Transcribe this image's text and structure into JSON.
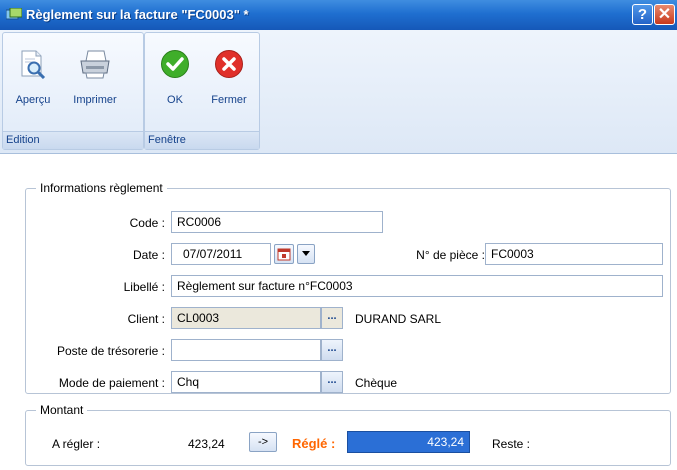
{
  "window": {
    "title": "Règlement sur la facture \"FC0003\" *",
    "help_label": "?",
    "close_label": "✕"
  },
  "ribbon": {
    "groups": [
      {
        "title": "Edition",
        "buttons": [
          {
            "label": "Aperçu",
            "icon": "preview-icon"
          },
          {
            "label": "Imprimer",
            "icon": "printer-icon"
          }
        ]
      },
      {
        "title": "Fenêtre",
        "buttons": [
          {
            "label": "OK",
            "icon": "check-icon"
          },
          {
            "label": "Fermer",
            "icon": "close-icon"
          }
        ]
      }
    ]
  },
  "info": {
    "legend": "Informations règlement",
    "code_label": "Code :",
    "code_value": "RC0006",
    "date_label": "Date :",
    "date_value": "07/07/2011",
    "piece_label": "N° de pièce :",
    "piece_value": "FC0003",
    "libelle_label": "Libellé :",
    "libelle_value": "Règlement sur facture n°FC0003",
    "client_label": "Client :",
    "client_code": "CL0003",
    "client_name": "DURAND SARL",
    "poste_label": "Poste de trésorerie :",
    "poste_value": "",
    "mode_label": "Mode de paiement :",
    "mode_code": "Chq",
    "mode_name": "Chèque",
    "lookup_label": "..."
  },
  "montant": {
    "legend": "Montant",
    "a_regler_label": "A régler :",
    "a_regler_value": "423,24",
    "transfer_label": "->",
    "regle_label": "Réglé :",
    "regle_value": "423,24",
    "reste_label": "Reste :"
  },
  "colors": {
    "title_bar": "#1f6fd0",
    "accent_orange": "#ff6600",
    "selection_blue": "#2b6fd6"
  }
}
